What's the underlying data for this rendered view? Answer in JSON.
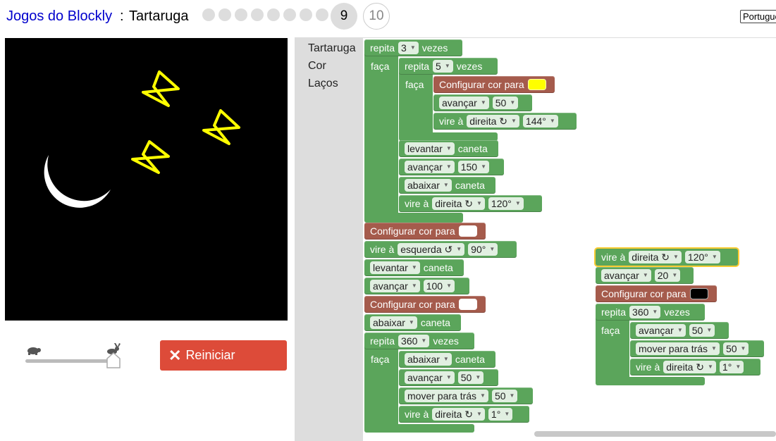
{
  "header": {
    "app_title": "Jogos do Blockly",
    "separator": " : ",
    "page_title": "Tartaruga",
    "levels_done": 8,
    "current_level": "9",
    "next_level": "10",
    "language": "Português"
  },
  "reset_label": "Reiniciar",
  "toolbox": [
    "Tartaruga",
    "Cor",
    "Laços"
  ],
  "colors": {
    "yellow": "#ffff00",
    "white": "#ffffff",
    "black": "#000000",
    "loop_green": "#5ba55b",
    "color_brown": "#a55b4c",
    "reset_red": "#dd4b39"
  },
  "stack1": {
    "repeat_outer": {
      "word": "repita",
      "count": "3",
      "times": "vezes",
      "do": "faça"
    },
    "repeat_inner": {
      "word": "repita",
      "count": "5",
      "times": "vezes",
      "do": "faça"
    },
    "set_color_1": "Configurar cor para",
    "fwd_1": {
      "label": "avançar",
      "value": "50"
    },
    "turn_1": {
      "label": "vire à",
      "dir": "direita ↻",
      "value": "144°"
    },
    "penup_1": {
      "label": "levantar",
      "suffix": "caneta"
    },
    "fwd_2": {
      "label": "avançar",
      "value": "150"
    },
    "pendown_1": {
      "label": "abaixar",
      "suffix": "caneta"
    },
    "turn_2": {
      "label": "vire à",
      "dir": "direita ↻",
      "value": "120°"
    },
    "set_color_2": "Configurar cor para",
    "turn_3": {
      "label": "vire à",
      "dir": "esquerda ↺",
      "value": "90°"
    },
    "penup_2": {
      "label": "levantar",
      "suffix": "caneta"
    },
    "fwd_3": {
      "label": "avançar",
      "value": "100"
    },
    "set_color_3": "Configurar cor para",
    "pendown_2": {
      "label": "abaixar",
      "suffix": "caneta"
    },
    "repeat_3": {
      "word": "repita",
      "count": "360",
      "times": "vezes",
      "do": "faça"
    },
    "pendown_3": {
      "label": "abaixar",
      "suffix": "caneta"
    },
    "fwd_4": {
      "label": "avançar",
      "value": "50"
    },
    "back_1": {
      "label": "mover para trás",
      "value": "50"
    },
    "turn_4": {
      "label": "vire à",
      "dir": "direita ↻",
      "value": "1°"
    }
  },
  "stack2": {
    "turn_1": {
      "label": "vire à",
      "dir": "direita ↻",
      "value": "120°"
    },
    "fwd_1": {
      "label": "avançar",
      "value": "20"
    },
    "set_color": "Configurar cor para",
    "repeat": {
      "word": "repita",
      "count": "360",
      "times": "vezes",
      "do": "faça"
    },
    "fwd_2": {
      "label": "avançar",
      "value": "50"
    },
    "back_1": {
      "label": "mover para trás",
      "value": "50"
    },
    "turn_2": {
      "label": "vire à",
      "dir": "direita ↻",
      "value": "1°"
    }
  }
}
